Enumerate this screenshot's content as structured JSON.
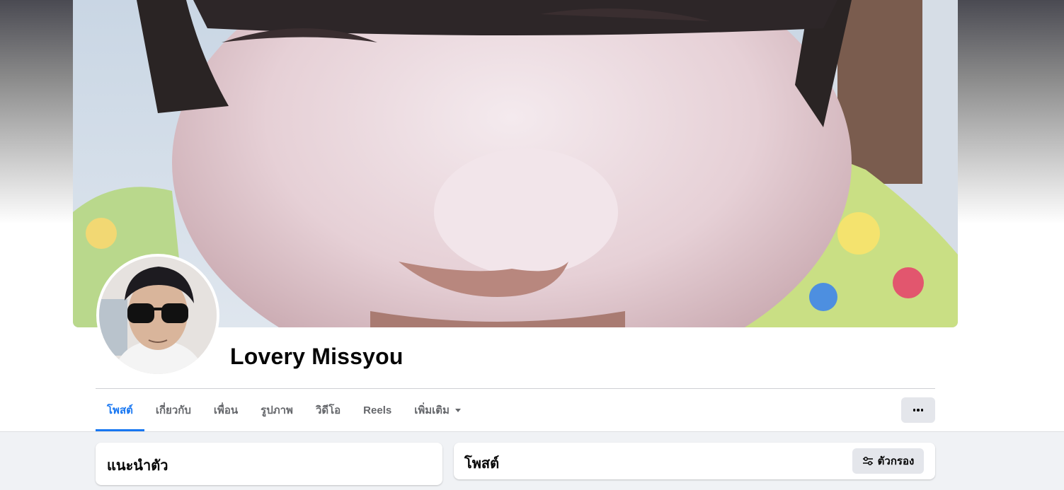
{
  "profile": {
    "name": "Lovery Missyou"
  },
  "tabs": [
    {
      "label": "โพสต์",
      "active": true
    },
    {
      "label": "เกี่ยวกับ",
      "active": false
    },
    {
      "label": "เพื่อน",
      "active": false
    },
    {
      "label": "รูปภาพ",
      "active": false
    },
    {
      "label": "วิดีโอ",
      "active": false
    },
    {
      "label": "Reels",
      "active": false
    },
    {
      "label": "เพิ่มเติม",
      "active": false,
      "dropdown": true
    }
  ],
  "intro_card": {
    "title": "แนะนำตัว"
  },
  "posts_card": {
    "title": "โพสต์",
    "filter_label": "ตัวกรอง"
  },
  "icons": {
    "more": "more-dots-icon",
    "filter": "filter-sliders-icon",
    "dropdown": "caret-down-icon"
  },
  "colors": {
    "accent": "#1877f2",
    "tab_text": "#65676b",
    "name_text": "#050505",
    "button_bg": "#e4e6eb",
    "page_bg": "#f0f2f5"
  }
}
